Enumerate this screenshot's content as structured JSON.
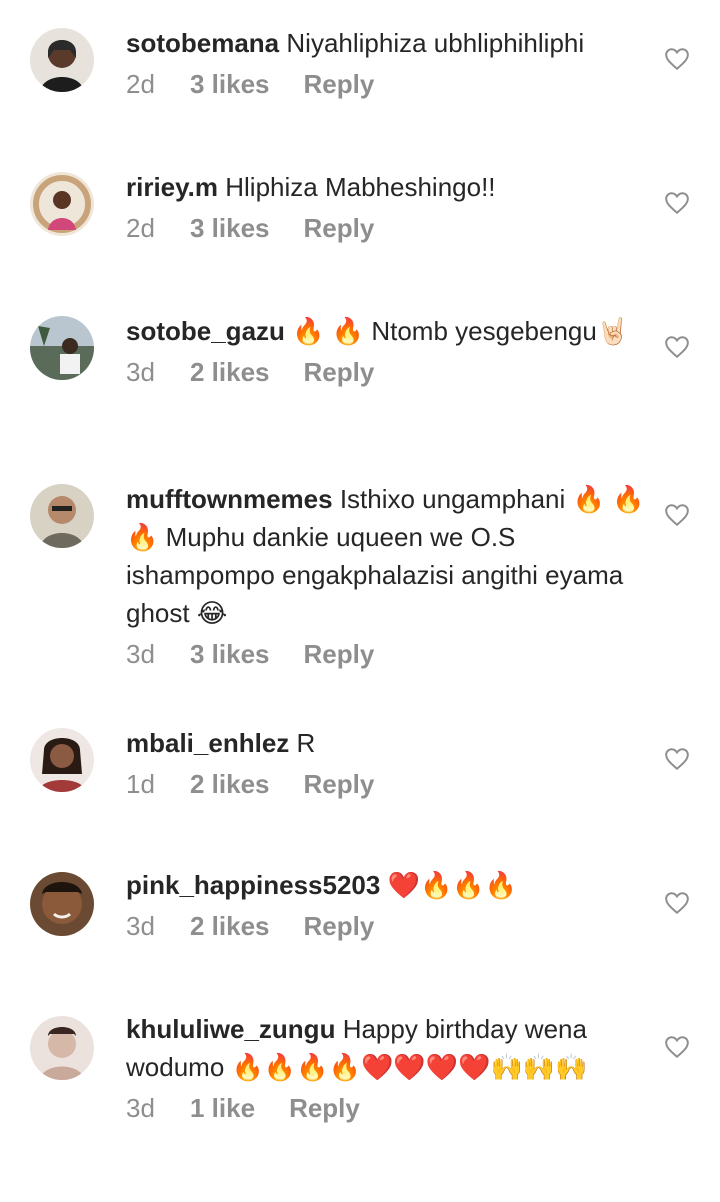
{
  "comments": [
    {
      "username": "sotobemana",
      "text": "Niyahliphiza ubhliphihliphi",
      "time": "2d",
      "likes": "3 likes",
      "reply": "Reply",
      "avatar_color": "#2b2b2b"
    },
    {
      "username": "ririey.m",
      "text": "Hliphiza Mabheshingo!!",
      "time": "2d",
      "likes": "3 likes",
      "reply": "Reply",
      "avatar_color": "#c9a37a"
    },
    {
      "username": "sotobe_gazu",
      "text": "🔥 🔥 Ntomb yesgebengu🤘🏻",
      "time": "3d",
      "likes": "2 likes",
      "reply": "Reply",
      "avatar_color": "#5b6b5a"
    },
    {
      "username": "mufftownmemes",
      "text": "Isthixo ungamphani 🔥 🔥 🔥 Muphu dankie uqueen we O.S ishampompo engakphalazisi angithi eyama ghost 😂",
      "time": "3d",
      "likes": "3 likes",
      "reply": "Reply",
      "avatar_color": "#9e9a8f"
    },
    {
      "username": "mbali_enhlez",
      "text": "R",
      "time": "1d",
      "likes": "2 likes",
      "reply": "Reply",
      "avatar_color": "#7a3b3b"
    },
    {
      "username": "pink_happiness5203",
      "text": "❤️🔥🔥🔥",
      "time": "3d",
      "likes": "2 likes",
      "reply": "Reply",
      "avatar_color": "#4a3428"
    },
    {
      "username": "khululiwe_zungu",
      "text": "Happy birthday wena wodumo 🔥🔥🔥🔥❤️❤️❤️❤️🙌🙌🙌",
      "time": "3d",
      "likes": "1 like",
      "reply": "Reply",
      "avatar_color": "#d9c6c0"
    }
  ],
  "icons": {
    "like": "heart-outline-icon"
  }
}
